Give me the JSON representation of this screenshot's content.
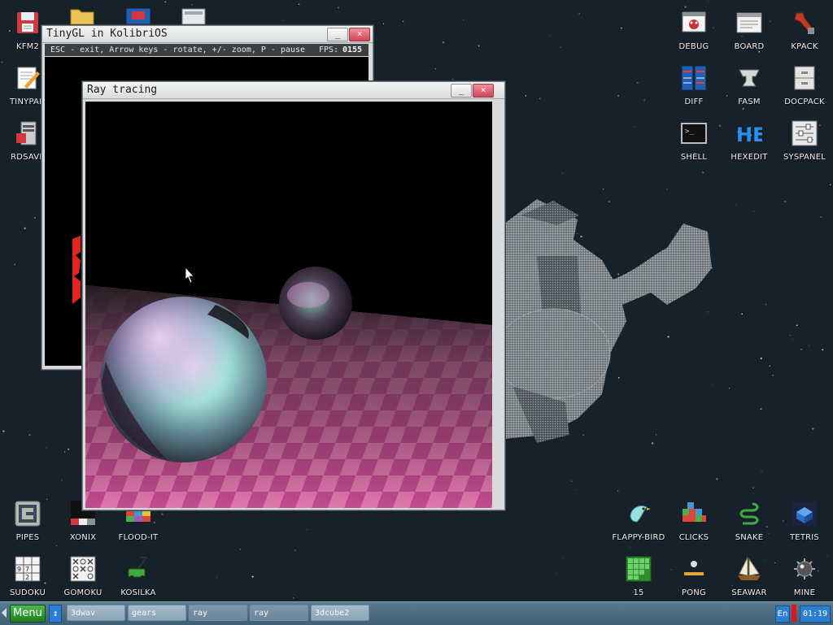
{
  "desktop": {
    "icons_left_top": [
      {
        "label": "KFM2",
        "icon": "floppy-disk-icon"
      },
      {
        "label": "TINYPAD",
        "icon": "notepad-pencil-icon"
      },
      {
        "label": "RDSAVE",
        "icon": "server-save-icon"
      }
    ],
    "icons_right_top": [
      {
        "label": "DEBUG",
        "icon": "bug-monitor-icon"
      },
      {
        "label": "BOARD",
        "icon": "board-window-icon"
      },
      {
        "label": "KPACK",
        "icon": "wrench-package-icon"
      },
      {
        "label": "DIFF",
        "icon": "diff-compare-icon"
      },
      {
        "label": "FASM",
        "icon": "anvil-icon"
      },
      {
        "label": "DOCPACK",
        "icon": "cabinet-icon"
      },
      {
        "label": "SHELL",
        "icon": "terminal-icon"
      },
      {
        "label": "HEXEDIT",
        "icon": "hex-editor-icon"
      },
      {
        "label": "SYSPANEL",
        "icon": "sliders-panel-icon"
      }
    ],
    "icons_left_bottom": [
      {
        "label": "PIPES",
        "icon": "pipes-icon"
      },
      {
        "label": "XONIX",
        "icon": "xonix-icon"
      },
      {
        "label": "FLOOD-IT",
        "icon": "color-grid-icon"
      },
      {
        "label": "SUDOKU",
        "icon": "sudoku-icon"
      },
      {
        "label": "GOMOKU",
        "icon": "tic-tac-grid-icon"
      },
      {
        "label": "KOSILKA",
        "icon": "lawn-mower-icon"
      }
    ],
    "icons_right_bottom": [
      {
        "label": "FLAPPY-BIRD",
        "icon": "bird-icon"
      },
      {
        "label": "CLICKS",
        "icon": "colored-blocks-icon"
      },
      {
        "label": "SNAKE",
        "icon": "snake-icon"
      },
      {
        "label": "TETRIS",
        "icon": "tetris-cube-icon"
      },
      {
        "label": "15",
        "icon": "fifteen-puzzle-icon"
      },
      {
        "label": "PONG",
        "icon": "pong-icon"
      },
      {
        "label": "SEAWAR",
        "icon": "sailing-ship-icon"
      },
      {
        "label": "MINE",
        "icon": "mine-icon"
      }
    ],
    "partial_icons_top": [
      "folder-icon",
      "red-app-icon",
      "calculator-icon"
    ]
  },
  "tinygl_window": {
    "title": "TinyGL in KolibriOS",
    "status_text": "ESC - exit, Arrow keys - rotate, +/- zoom, P - pause",
    "fps_label": "FPS:",
    "fps_value": "0155",
    "minimize_label": "_",
    "close_label": "×"
  },
  "ray_window": {
    "title": "Ray tracing",
    "minimize_label": "_",
    "close_label": "×"
  },
  "taskbar": {
    "menu_label": "Menu",
    "switch_label": "↕",
    "tasks": [
      {
        "label": "3dwav"
      },
      {
        "label": "gears"
      },
      {
        "label": "ray"
      },
      {
        "label": "ray"
      },
      {
        "label": "3dcube2"
      }
    ],
    "language": "En",
    "clock": "01:19"
  },
  "colors": {
    "desktop_bg": "#162129",
    "taskbar": "#4a6a80",
    "accent_blue": "#2a7fd4",
    "menu_green": "#2e8f2e",
    "close_red": "#d2445a"
  }
}
